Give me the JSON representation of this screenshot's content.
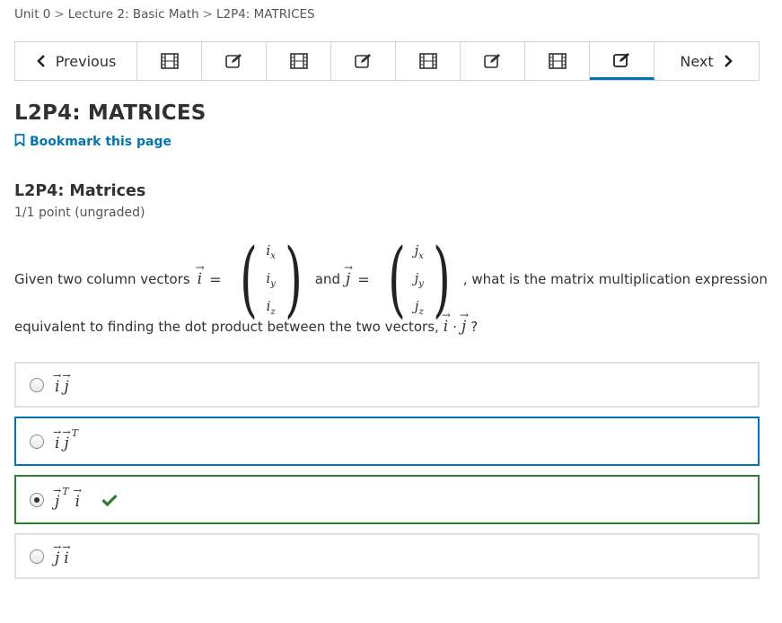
{
  "breadcrumb": {
    "items": [
      "Unit 0",
      "Lecture 2: Basic Math",
      "L2P4: MATRICES"
    ],
    "separator": ">"
  },
  "sequence_nav": {
    "previous_label": "Previous",
    "next_label": "Next",
    "tabs": [
      "video-icon",
      "edit-icon",
      "video-icon",
      "edit-icon",
      "video-icon",
      "edit-icon",
      "video-icon",
      "edit-icon"
    ],
    "active_tab_index": 7,
    "accent_color": "#0075b4"
  },
  "page": {
    "title": "L2P4: MATRICES",
    "bookmark_label": "Bookmark this page"
  },
  "problem": {
    "title": "L2P4: Matrices",
    "progress": "1/1 point (ungraded)",
    "question": {
      "part1": "Given two column vectors",
      "var_i": "i",
      "equals": "=",
      "i_components": [
        "x",
        "y",
        "z"
      ],
      "and": "and",
      "var_j": "j",
      "j_components": [
        "x",
        "y",
        "z"
      ],
      "part2": ", what is the matrix multiplication expression",
      "line2": "equivalent to finding the dot product between the two vectors,",
      "dot": "·",
      "question_mark": "?"
    },
    "choices": [
      {
        "terms": [
          "i",
          "j"
        ],
        "sup": [
          "",
          ""
        ],
        "selected": false,
        "state": "default"
      },
      {
        "terms": [
          "i",
          "j"
        ],
        "sup": [
          "",
          "T"
        ],
        "selected": false,
        "state": "focused"
      },
      {
        "terms": [
          "j",
          "i"
        ],
        "sup": [
          "T",
          ""
        ],
        "selected": true,
        "state": "correct"
      },
      {
        "terms": [
          "j",
          "i"
        ],
        "sup": [
          "",
          ""
        ],
        "selected": false,
        "state": "default"
      }
    ],
    "correct_color": "#2e7d32"
  }
}
